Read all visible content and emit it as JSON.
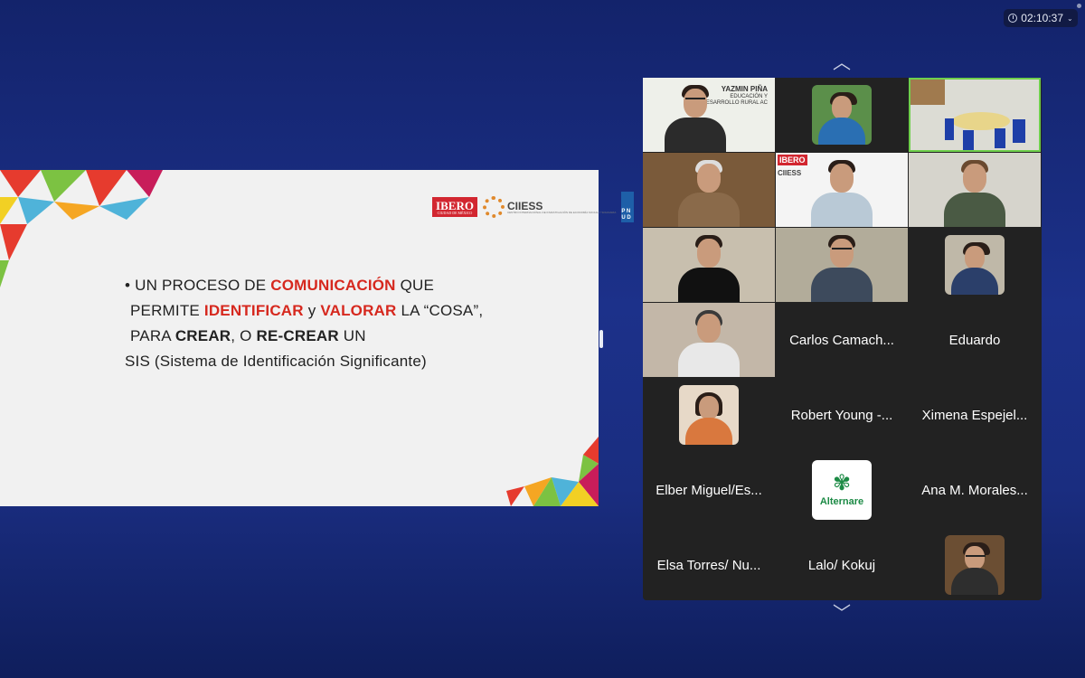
{
  "meeting": {
    "timer": "02:10:37"
  },
  "slide": {
    "logos": {
      "ibero": "IBERO",
      "ibero_sub": "CIUDAD DE MÉXICO",
      "ciiess": "CIIESS",
      "ciiess_sub": "CENTRO INTERNACIONAL DE INVESTIGACIÓN DE ECONOMÍA SOCIAL Y SOLIDARIA",
      "pnud": "P N U D"
    },
    "line1": {
      "bullet": "•",
      "a": "UN PROCESO DE ",
      "b": "COMUNICACIÓN",
      "c": " QUE"
    },
    "line2": {
      "a": "PERMITE ",
      "b": "IDENTIFICAR",
      "c": " y ",
      "d": "VALORAR",
      "e": " LA “COSA”,"
    },
    "line3": {
      "a": "PARA ",
      "b": "CREAR",
      "c": ", O ",
      "d": "RE-CREAR",
      "e": " UN"
    },
    "line4": "SIS (Sistema de Identificación Significante)"
  },
  "gallery": {
    "yazmin_name": "YAZMIN PIÑA",
    "yazmin_org1": "EDUCACIÓN Y",
    "yazmin_org2": "DESARROLLO RURAL AC",
    "ibero_tile": "IBERO",
    "ciiess_tile": "CIIESS",
    "participants": [
      "Carlos Camach...",
      "Eduardo",
      "Robert Young -...",
      "Ximena Espejel...",
      "Elber Miguel/Es...",
      "Ana M. Morales...",
      "Elsa Torres/ Nu...",
      "Lalo/ Kokuj"
    ],
    "alternare": "Alternare"
  },
  "colors": {
    "accent_red": "#d6281e",
    "active_speaker": "#6fcf4c"
  }
}
